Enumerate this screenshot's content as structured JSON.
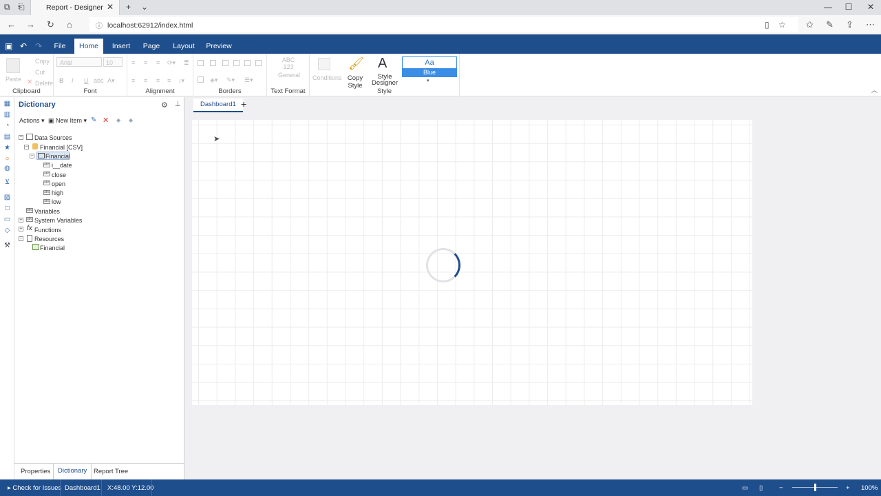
{
  "browser": {
    "tab_title": "Report - Designer",
    "url": "localhost:62912/index.html"
  },
  "ribbon": {
    "tabs": [
      "File",
      "Home",
      "Insert",
      "Page",
      "Layout",
      "Preview"
    ],
    "active_tab": "Home",
    "clipboard": {
      "paste": "Paste",
      "copy": "Copy",
      "cut": "Cut",
      "delete": "Delete",
      "label": "Clipboard"
    },
    "font": {
      "name": "Arial",
      "size": "10",
      "label": "Font"
    },
    "alignment": {
      "label": "Alignment"
    },
    "borders": {
      "label": "Borders"
    },
    "text_format": {
      "preview": "ABC 123",
      "value": "General",
      "label": "Text Format"
    },
    "style": {
      "conditions": "Conditions",
      "copy_style": "Copy Style",
      "style_designer_1": "Style",
      "style_designer_2": "Designer",
      "preview_text": "Aa",
      "preview_name": "Blue",
      "label": "Style"
    }
  },
  "dictionary": {
    "title": "Dictionary",
    "actions": "Actions",
    "new_item": "New Item",
    "tree": {
      "data_sources": "Data Sources",
      "financial_csv": "Financial [CSV]",
      "financial": "Financial",
      "fields": [
        "i__date",
        "close",
        "open",
        "high",
        "low"
      ],
      "variables": "Variables",
      "system_variables": "System Variables",
      "functions": "Functions",
      "resources": "Resources",
      "resource_financial": "Financial"
    },
    "bottom_tabs": [
      "Properties",
      "Dictionary",
      "Report Tree"
    ]
  },
  "designer": {
    "page_tab": "Dashboard1"
  },
  "status": {
    "check": "Check for Issues",
    "page": "Dashboard1",
    "coords": "X:48.00 Y:12.00",
    "zoom": "100%",
    "zoom_fraction": 0.5
  },
  "colors": {
    "accent": "#1f4e8c",
    "style_blue": "#3a8ee6"
  }
}
